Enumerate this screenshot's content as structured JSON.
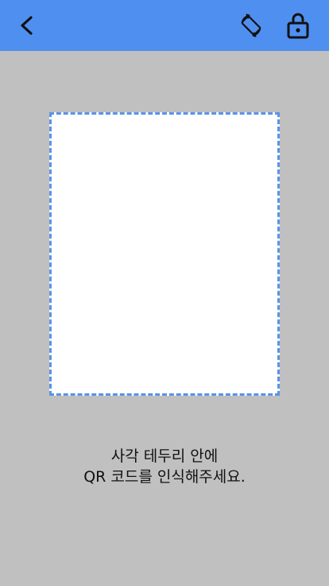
{
  "header": {
    "background_color": "#4f8ff0",
    "back_icon": "chevron-left-icon",
    "rotate_icon": "screen-rotation-icon",
    "lock_icon": "unlock-icon"
  },
  "scanner": {
    "frame_border_color": "#5a93e8",
    "frame_fill_color": "#ffffff"
  },
  "instructions": {
    "line1": "사각 테두리 안에",
    "line2": "QR 코드를 인식해주세요."
  },
  "colors": {
    "background": "#c0c0c0",
    "text": "#111111"
  }
}
